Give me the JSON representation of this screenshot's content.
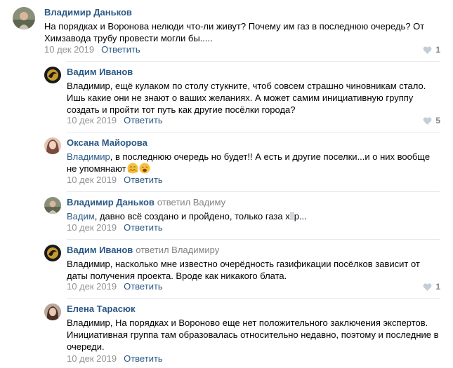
{
  "comments": [
    {
      "author": "Владимир Даньков",
      "text": "На порядках и Воронова нелюди что-ли живут? Почему им газ в последнюю очередь? От Химзавода трубу провести могли бы.....",
      "date": "10 дек 2019",
      "reply": "Ответить",
      "likes": "1",
      "avatar_icon": "user-photo-icon"
    },
    {
      "author": "Вадим Иванов",
      "text": "Владимир, ещё кулаком по столу стукните, чтоб совсем страшно чиновникам стало. Ишь какие они не знают о ваших желаниях. А может самим инициативную группу создать и пройти тот путь как другие посёлки города?",
      "date": "10 дек 2019",
      "reply": "Ответить",
      "likes": "5",
      "avatar_icon": "mortal-kombat-logo-icon"
    },
    {
      "author": "Оксана Майорова",
      "mention": "Владимир",
      "text": ", в последнюю очередь но будет!! А есть и другие поселки...и о них вообще не упомянают",
      "date": "10 дек 2019",
      "reply": "Ответить",
      "avatar_icon": "user-photo-icon",
      "emojis": [
        "hugging-face-icon",
        "weary-face-icon"
      ]
    },
    {
      "author": "Владимир Даньков",
      "replied_to": "ответил Вадиму",
      "mention": "Вадим",
      "text_before": ", давно всё создано и пройдено, только газа х",
      "text_after": "р...",
      "date": "10 дек 2019",
      "reply": "Ответить",
      "avatar_icon": "user-photo-icon"
    },
    {
      "author": "Вадим Иванов",
      "replied_to": "ответил Владимиру",
      "text": "Владимир, насколько мне известно очерёдность газификации посёлков зависит от даты получения проекта. Вроде как никакого блата.",
      "date": "10 дек 2019",
      "reply": "Ответить",
      "likes": "1",
      "avatar_icon": "mortal-kombat-logo-icon"
    },
    {
      "author": "Елена Тарасюк",
      "text": "Владимир, На порядках и Вороново еще нет положительного заключения экспертов. Инициативная группа там образовалась относительно недавно, поэтому и последние в очереди.",
      "date": "10 дек 2019",
      "reply": "Ответить",
      "avatar_icon": "user-photo-icon"
    }
  ]
}
